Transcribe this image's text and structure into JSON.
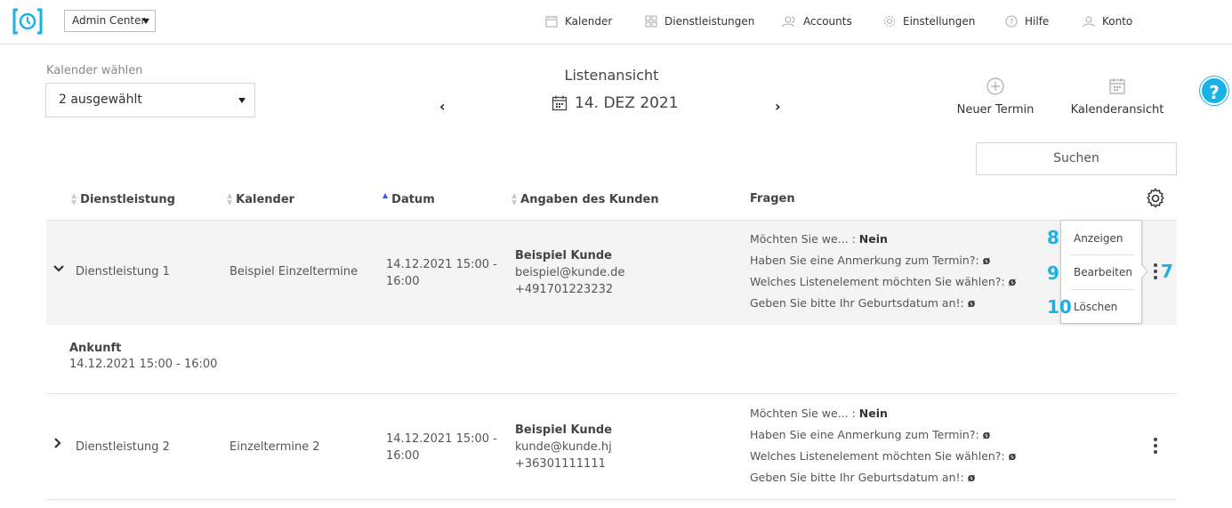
{
  "header": {
    "org_select": "Admin Center",
    "nav": {
      "calendar": "Kalender",
      "services": "Dienstleistungen",
      "accounts": "Accounts",
      "settings": "Einstellungen",
      "help": "Hilfe",
      "account": "Konto"
    }
  },
  "toolbar": {
    "calendar_label": "Kalender wählen",
    "calendar_value": "2 ausgewählt",
    "view_title": "Listenansicht",
    "date": "14. DEZ 2021",
    "prev": "‹",
    "next": "›",
    "new_appointment": "Neuer Termin",
    "calendar_view": "Kalenderansicht",
    "search_placeholder": "Suchen",
    "help": "?"
  },
  "table": {
    "columns": {
      "service": "Dienstleistung",
      "calendar": "Kalender",
      "date": "Datum",
      "customer": "Angaben des Kunden",
      "questions": "Fragen"
    },
    "rows": [
      {
        "service": "Dienstleistung 1",
        "calendar": "Beispiel Einzeltermine",
        "date_line1": "14.12.2021 15:00 -",
        "date_line2": "16:00",
        "customer_name": "Beispiel Kunde",
        "customer_email": "beispiel@kunde.de",
        "customer_phone": "+491701223232",
        "questions": [
          {
            "q": "Möchten Sie we... :",
            "a": "Nein"
          },
          {
            "q": "Haben Sie eine Anmerkung zum Termin?:",
            "a": "ø"
          },
          {
            "q": "Welches Listenelement möchten Sie wählen?:",
            "a": "ø"
          },
          {
            "q": "Geben Sie bitte Ihr Geburtsdatum an!:",
            "a": "ø"
          }
        ]
      },
      {
        "service": "Dienstleistung 2",
        "calendar": "Einzeltermine 2",
        "date_line1": "14.12.2021 15:00 -",
        "date_line2": "16:00",
        "customer_name": "Beispiel Kunde",
        "customer_email": "kunde@kunde.hj",
        "customer_phone": "+36301111111",
        "questions": [
          {
            "q": "Möchten Sie we... :",
            "a": "Nein"
          },
          {
            "q": "Haben Sie eine Anmerkung zum Termin?:",
            "a": "ø"
          },
          {
            "q": "Welches Listenelement möchten Sie wählen?:",
            "a": "ø"
          },
          {
            "q": "Geben Sie bitte Ihr Geburtsdatum an!:",
            "a": "ø"
          }
        ]
      }
    ],
    "arrival": {
      "title": "Ankunft",
      "time": "14.12.2021 15:00 - 16:00"
    }
  },
  "row_menu": {
    "view": "Anzeigen",
    "edit": "Bearbeiten",
    "delete": "Löschen"
  },
  "markers": {
    "m7": "7",
    "m8": "8",
    "m9": "9",
    "m10": "10"
  },
  "colors": {
    "accent": "#1ab0e8",
    "sort_active": "#3b5bdb",
    "row_highlight": "#f4f4f4"
  }
}
